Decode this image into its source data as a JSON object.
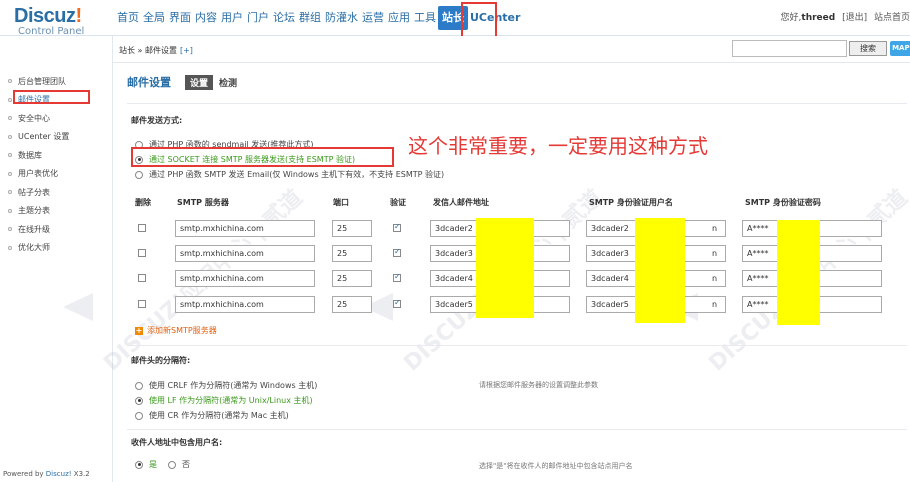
{
  "header": {
    "logo_main": "Discuz",
    "logo_bang": "!",
    "logo_sub": "Control Panel",
    "nav": [
      "首页",
      "全局",
      "界面",
      "内容",
      "用户",
      "门户",
      "论坛",
      "群组",
      "防灌水",
      "运营",
      "应用",
      "工具"
    ],
    "nav_active": "站长",
    "nav_ucenter": "UCenter",
    "greeting": "您好,",
    "username": "threed",
    "logout": "[退出]",
    "site_home": "站点首页"
  },
  "subbar": {
    "breadcrumb": "站长 » 邮件设置",
    "breadcrumb_add": "[+]",
    "search_button": "搜索",
    "map_button": "MAP +"
  },
  "sidebar": {
    "items": [
      "后台管理团队",
      "邮件设置",
      "安全中心",
      "UCenter 设置",
      "数据库",
      "用户表优化",
      "帖子分表",
      "主题分表",
      "在线升级",
      "优化大师"
    ],
    "active_index": 1,
    "powered_prefix": "Powered by ",
    "powered_brand": "Discuz!",
    "powered_version": " X3.2"
  },
  "main": {
    "title": "邮件设置",
    "tab_settings": "设置",
    "tab_check": "检测",
    "send_method_title": "邮件发送方式:",
    "send_options": [
      {
        "label": "通过 PHP 函数的 sendmail 发送(推荐此方式)",
        "checked": false
      },
      {
        "label": "通过 SOCKET 连接 SMTP 服务器发送(支持 ESMTP 验证)",
        "checked": true
      },
      {
        "label": "通过 PHP 函数 SMTP 发送 Email(仅 Windows 主机下有效，不支持 ESMTP 验证)",
        "checked": false
      }
    ],
    "annotation": "这个非常重要，一定要用这种方式",
    "smtp_headers": {
      "delete": "删除",
      "server": "SMTP 服务器",
      "port": "端口",
      "auth": "验证",
      "from": "发信人邮件地址",
      "user": "SMTP 身份验证用户名",
      "pass": "SMTP 身份验证密码"
    },
    "smtp_rows": [
      {
        "server": "smtp.mxhichina.com",
        "port": "25",
        "from": "3dcader2",
        "user": "3dcader2",
        "pass": "A****",
        "user_suffix": "n"
      },
      {
        "server": "smtp.mxhichina.com",
        "port": "25",
        "from": "3dcader3",
        "user": "3dcader3",
        "pass": "A****",
        "user_suffix": "n"
      },
      {
        "server": "smtp.mxhichina.com",
        "port": "25",
        "from": "3dcader4",
        "user": "3dcader4",
        "pass": "A****",
        "user_suffix": "n"
      },
      {
        "server": "smtp.mxhichina.com",
        "port": "25",
        "from": "3dcader5",
        "user": "3dcader5",
        "pass": "A****",
        "user_suffix": "n"
      }
    ],
    "add_smtp": "添加新SMTP服务器",
    "separator_title": "邮件头的分隔符:",
    "separator_options": [
      {
        "label": "使用 CRLF 作为分隔符(通常为 Windows 主机)",
        "checked": false
      },
      {
        "label": "使用 LF 作为分隔符(通常为 Unix/Linux 主机)",
        "checked": true
      },
      {
        "label": "使用 CR 作为分隔符(通常为 Mac 主机)",
        "checked": false
      }
    ],
    "separator_hint": "请根据您邮件服务器的设置调整此参数",
    "include_user_title": "收件人地址中包含用户名:",
    "include_yes": "是",
    "include_no": "否",
    "include_hint": "选择\"是\"将在收件人的邮件地址中包含站点用户名"
  },
  "watermark": "DISCUZ!应用中心 | 贰道"
}
